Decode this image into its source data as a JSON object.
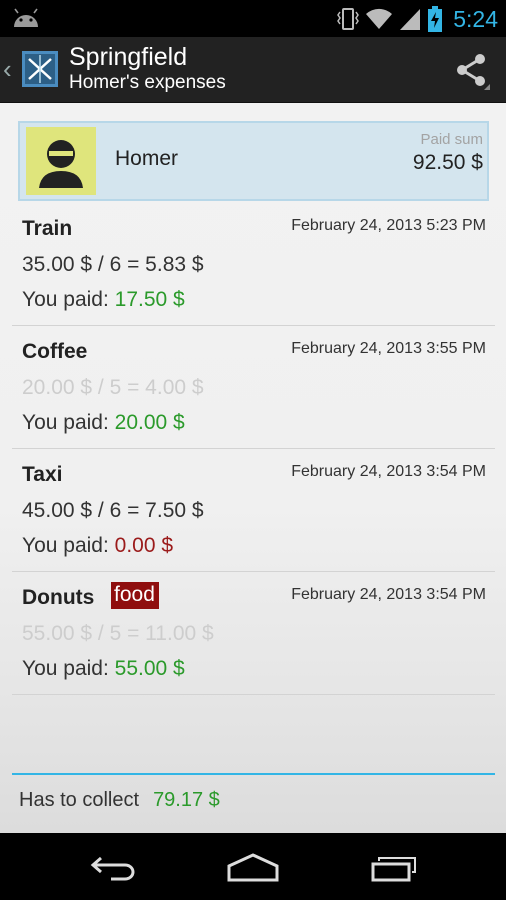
{
  "status_bar": {
    "time": "5:24",
    "icons": [
      "android-icon",
      "vibrate-icon",
      "wifi-icon",
      "signal-icon",
      "battery-charging-icon"
    ],
    "clock_color": "#33b5e5"
  },
  "action_bar": {
    "title": "Springfield",
    "subtitle": "Homer's expenses",
    "up_glyph": "‹",
    "share_icon": "share-icon"
  },
  "payer": {
    "name": "Homer",
    "paid_label": "Paid sum",
    "paid_value": "92.50 $",
    "avatar_icon": "person-avatar-icon"
  },
  "expenses": [
    {
      "name": "Train",
      "date": "February 24, 2013 5:23 PM",
      "formula": "35.00 $ / 6 = 5.83 $",
      "formula_muted": false,
      "paid_label": "You paid:",
      "paid": "17.50 $",
      "paid_zero": false,
      "tag": ""
    },
    {
      "name": "Coffee",
      "date": "February 24, 2013 3:55 PM",
      "formula": "20.00 $ / 5 = 4.00 $",
      "formula_muted": true,
      "paid_label": "You paid:",
      "paid": "20.00 $",
      "paid_zero": false,
      "tag": ""
    },
    {
      "name": "Taxi",
      "date": "February 24, 2013 3:54 PM",
      "formula": "45.00 $ / 6 = 7.50 $",
      "formula_muted": false,
      "paid_label": "You paid:",
      "paid": "0.00 $",
      "paid_zero": true,
      "tag": ""
    },
    {
      "name": "Donuts",
      "date": "February 24, 2013 3:54 PM",
      "formula": "55.00 $ / 5 = 11.00 $",
      "formula_muted": true,
      "paid_label": "You paid:",
      "paid": "55.00 $",
      "paid_zero": false,
      "tag": "food"
    }
  ],
  "footer": {
    "label": "Has to collect",
    "amount": "79.17 $"
  },
  "colors": {
    "accent": "#33b5e5",
    "positive": "#2b9a2b",
    "negative": "#9b1b1b",
    "tag_bg": "#8f0e0e",
    "payer_bg": "#d4e5ee"
  },
  "nav_bar": {
    "buttons": [
      "back-icon",
      "home-icon",
      "recents-icon"
    ]
  }
}
